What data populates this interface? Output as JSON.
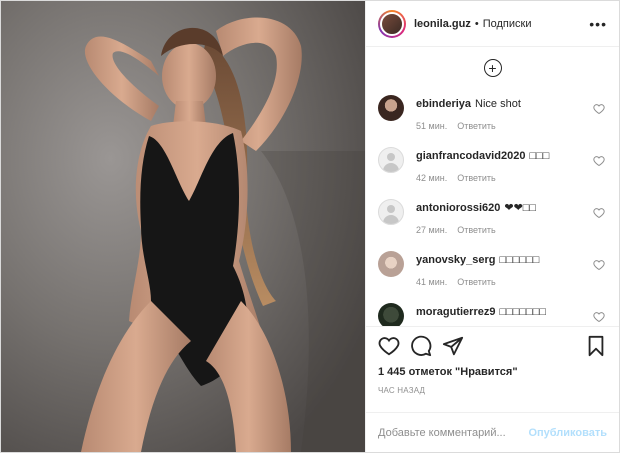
{
  "header": {
    "username": "leonila.guz",
    "dot": "•",
    "follow_label": "Подписки",
    "more_icon": "more-horizontal-icon"
  },
  "load_more_icon": "plus-circle-icon",
  "comments": [
    {
      "username": "ebinderiya",
      "text": "Nice shot",
      "time": "51 мин.",
      "reply": "Ответить"
    },
    {
      "username": "gianfrancodavid2020",
      "text": "□□□",
      "time": "42 мин.",
      "reply": "Ответить"
    },
    {
      "username": "antoniorossi620",
      "text": "❤❤□□",
      "time": "27 мин.",
      "reply": "Ответить"
    },
    {
      "username": "yanovsky_serg",
      "text": "□□□□□□",
      "time": "41 мин.",
      "reply": "Ответить"
    },
    {
      "username": "moragutierrez9",
      "text": "□□□□□□□",
      "time": "",
      "reply": ""
    }
  ],
  "actions": {
    "like_icon": "heart-icon",
    "comment_icon": "comment-icon",
    "share_icon": "send-icon",
    "save_icon": "bookmark-icon"
  },
  "likes_text": "1 445 отметок \"Нравится\"",
  "timestamp": "ЧАС НАЗАД",
  "add_comment": {
    "placeholder": "Добавьте комментарий...",
    "publish_label": "Опубликовать"
  },
  "colors": {
    "text": "#262626",
    "muted": "#8e8e8e",
    "border": "#dbdbdb",
    "publish_disabled": "#b2dffc"
  }
}
